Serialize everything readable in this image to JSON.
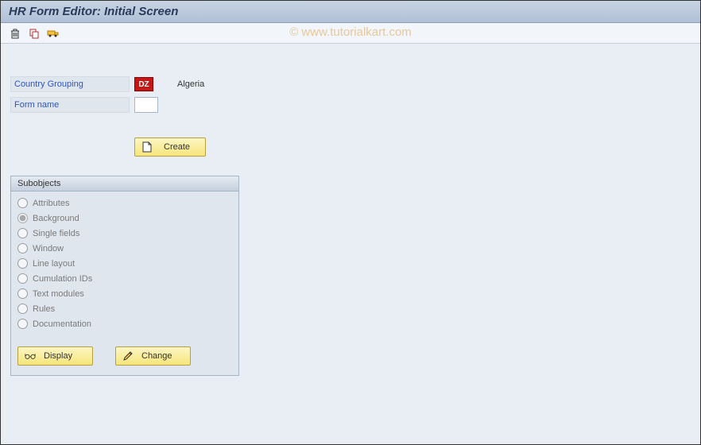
{
  "title": "HR Form Editor: Initial Screen",
  "watermark": "© www.tutorialkart.com",
  "fields": {
    "country_grouping": {
      "label": "Country Grouping",
      "badge": "DZ",
      "text": "Algeria"
    },
    "form_name": {
      "label": "Form name",
      "value": ""
    }
  },
  "buttons": {
    "create": "Create",
    "display": "Display",
    "change": "Change"
  },
  "subobjects": {
    "header": "Subobjects",
    "selected": 1,
    "items": [
      "Attributes",
      "Background",
      "Single fields",
      "Window",
      "Line layout",
      "Cumulation IDs",
      "Text modules",
      "Rules",
      "Documentation"
    ]
  }
}
